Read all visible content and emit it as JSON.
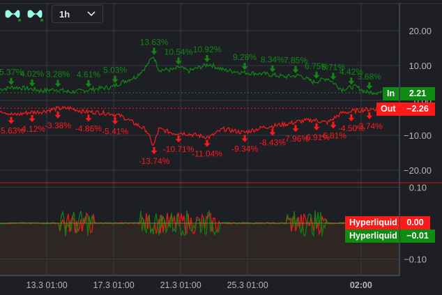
{
  "toolbar": {
    "interval": "1h",
    "icons": [
      "hyperliquid-logo-icon",
      "hyperliquid-logo-icon",
      "chevron-down-icon"
    ]
  },
  "colors": {
    "green": "#0f8a12",
    "red": "#ff1a1a",
    "bg": "#1e1f25",
    "grid": "#363944",
    "axis_text": "#b2b5be",
    "fill": "#2d2622"
  },
  "chart_data": [
    {
      "type": "line",
      "title": "In / Out",
      "yticks": [
        20,
        10,
        0,
        -10,
        -20
      ],
      "ytick_labels": [
        "20.00",
        "10.00",
        "0.00",
        "−10.00",
        "−20.00"
      ],
      "ylim": [
        -29,
        29
      ],
      "series": [
        {
          "name": "In",
          "color": "#0f8a12",
          "last_value_label": "2.21",
          "tag_label": "In",
          "x": [
            10.2,
            11.03,
            11.87,
            12.7,
            13.53,
            14.37,
            15.2,
            16.03,
            16.87,
            17.49,
            18.33,
            18.95,
            19.37,
            19.7,
            20.62,
            20.91,
            21.45,
            22.7,
            23.53,
            24.78,
            26.03,
            27.28,
            28.12,
            28.95,
            29.78,
            30.62,
            31.45,
            32.08,
            32.91,
            34.08
          ],
          "y": [
            3.2,
            3.8,
            3.4,
            2.8,
            3.2,
            2.4,
            2.8,
            3.4,
            3.8,
            5.2,
            6.8,
            9.8,
            12.8,
            8.8,
            8.8,
            9.6,
            8.4,
            10.4,
            8.8,
            8,
            7.6,
            6.8,
            7.2,
            5.2,
            6.4,
            3.2,
            4,
            2.4,
            2.3,
            2.21
          ],
          "annotations": [
            {
              "x": 10.87,
              "label": "5.37%"
            },
            {
              "x": 12.12,
              "label": "4.02%"
            },
            {
              "x": 13.66,
              "label": "3.28%"
            },
            {
              "x": 15.49,
              "label": "4.61%"
            },
            {
              "x": 17.08,
              "label": "5.03%"
            },
            {
              "x": 19.41,
              "label": "13.63%"
            },
            {
              "x": 20.87,
              "label": "10.54%"
            },
            {
              "x": 22.58,
              "label": "10.92%"
            },
            {
              "x": 24.83,
              "label": "9.28%"
            },
            {
              "x": 26.49,
              "label": "8.34%"
            },
            {
              "x": 27.87,
              "label": "7.85%"
            },
            {
              "x": 29.12,
              "label": "6.75%"
            },
            {
              "x": 30.12,
              "label": "6.71%"
            },
            {
              "x": 31.2,
              "label": "4.42%"
            },
            {
              "x": 32.28,
              "label": "3.68%"
            }
          ]
        },
        {
          "name": "Out",
          "color": "#ff1a1a",
          "last_value_label": "−2.26",
          "tag_label": "Out",
          "x": [
            10.2,
            11.03,
            11.87,
            12.7,
            13.53,
            14.37,
            15.2,
            16.03,
            16.87,
            17.49,
            18.33,
            18.95,
            19.37,
            19.7,
            20.62,
            20.91,
            21.45,
            22.7,
            23.53,
            24.78,
            26.03,
            27.28,
            28.12,
            28.95,
            29.78,
            30.62,
            31.45,
            32.08,
            32.91,
            34.08
          ],
          "y": [
            -2.8,
            -4.2,
            -3.5,
            -3.2,
            -2.4,
            -2.2,
            -3.2,
            -3.4,
            -3.8,
            -4.6,
            -6.8,
            -8.5,
            -13.2,
            -8.2,
            -9.4,
            -9.2,
            -9.6,
            -10.6,
            -8.2,
            -9.2,
            -7.6,
            -6.8,
            -6,
            -5.6,
            -6.4,
            -3.6,
            -3,
            -2.6,
            -2.4,
            -2.26
          ],
          "annotations": [
            {
              "x": 10.87,
              "label": "-5.63%"
            },
            {
              "x": 12.12,
              "label": "-4.12%"
            },
            {
              "x": 13.66,
              "label": "-3.38%"
            },
            {
              "x": 15.49,
              "label": "-4.86%"
            },
            {
              "x": 17.08,
              "label": "-5.41%"
            },
            {
              "x": 19.41,
              "label": "-13.74%"
            },
            {
              "x": 20.87,
              "label": "-10.71%"
            },
            {
              "x": 22.58,
              "label": "-11.04%"
            },
            {
              "x": 24.83,
              "label": "-9.34%"
            },
            {
              "x": 26.49,
              "label": "-8.43%"
            },
            {
              "x": 27.87,
              "label": "-7.96%"
            },
            {
              "x": 29.12,
              "label": "-6.91%"
            },
            {
              "x": 30.12,
              "label": "-6.81%"
            },
            {
              "x": 31.2,
              "label": "-4.50%"
            },
            {
              "x": 32.28,
              "label": "-3.74%"
            }
          ]
        }
      ]
    },
    {
      "type": "line",
      "title": "Funding",
      "yticks": [
        0.1,
        -0.1
      ],
      "ytick_labels": [
        "0.10",
        "−0.10"
      ],
      "ylim": [
        -0.145,
        0.115
      ],
      "series": [
        {
          "name": "Hyperliquid",
          "color": "#ff1a1a",
          "last_value_label": "0.00",
          "tag_label": "Hyperliquid"
        },
        {
          "name": "Hyperliquid",
          "color": "#0f8a12",
          "last_value_label": "−0.01",
          "tag_label": "Hyperliquid"
        }
      ]
    }
  ],
  "xaxis": {
    "ticks": [
      {
        "x": 13,
        "label": "13.3 01:00"
      },
      {
        "x": 17,
        "label": "17.3 01:00"
      },
      {
        "x": 21,
        "label": "21.3 01:00"
      },
      {
        "x": 25,
        "label": "25.3 01:00"
      },
      {
        "x": 31.78,
        "label": "02:00",
        "bold": true
      }
    ],
    "xlim": [
      10.2,
      34.08
    ]
  }
}
